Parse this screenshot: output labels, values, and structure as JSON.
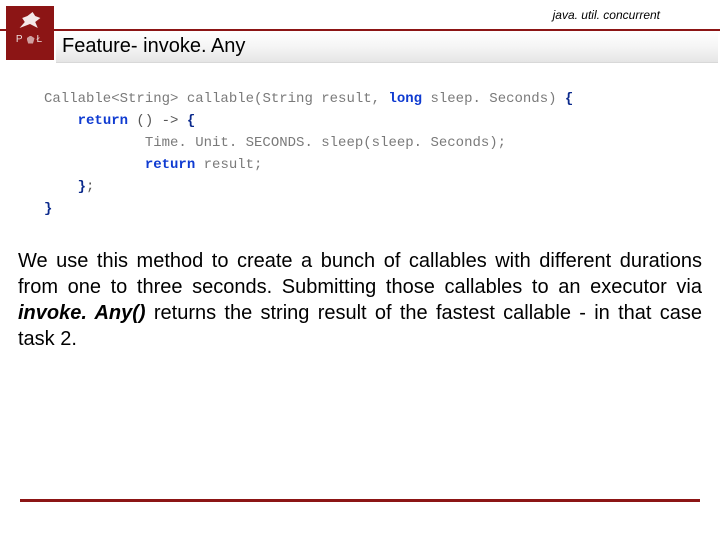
{
  "eyebrow": "java. util. concurrent",
  "title": "Feature- invoke. Any",
  "logo": {
    "left": "P",
    "right": "Ł"
  },
  "code": {
    "l1": {
      "t1": "Callable<String> ",
      "fn": "callable",
      "t2": "(String result, ",
      "kw": "long",
      "t3": " sleep. Seconds)",
      "br": " {"
    },
    "l2": {
      "indent": "    ",
      "kw": "return",
      "t1": " () -> ",
      "br": "{"
    },
    "l3": "            Time. Unit. SECONDS. sleep(sleep. Seconds);",
    "l4": {
      "indent": "            ",
      "kw": "return",
      "t1": " result;"
    },
    "l5": {
      "indent": "    ",
      "br": "}",
      "t1": ";"
    },
    "l6": {
      "br": "}"
    }
  },
  "paragraph": {
    "p1": "We use this method to create a bunch of callables with different durations from one to three seconds. Submitting those callables to an executor via ",
    "em": "invoke. Any()",
    "p2": " returns the string result of the fastest callable - in that case task 2."
  }
}
